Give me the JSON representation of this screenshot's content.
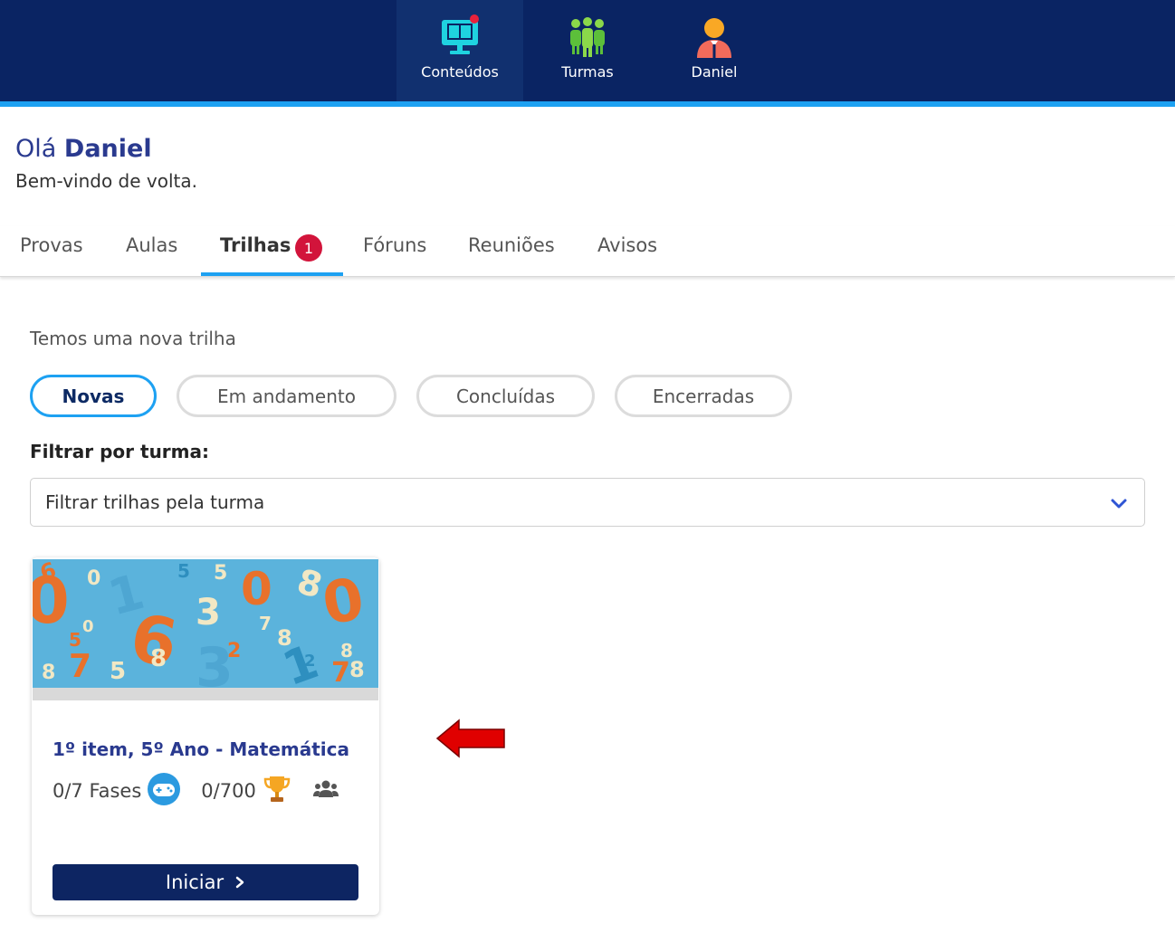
{
  "nav": {
    "items": [
      {
        "label": "Conteúdos",
        "icon": "monitor-book-icon",
        "active": true
      },
      {
        "label": "Turmas",
        "icon": "group-people-icon",
        "active": false
      },
      {
        "label": "Daniel",
        "icon": "user-avatar-icon",
        "active": false
      }
    ]
  },
  "greeting": {
    "hello": "Olá",
    "name": "Daniel",
    "welcome": "Bem-vindo de volta."
  },
  "tabs": {
    "items": [
      "Provas",
      "Aulas",
      "Trilhas",
      "Fóruns",
      "Reuniões",
      "Avisos"
    ],
    "active": "Trilhas",
    "badge": "1"
  },
  "intro": "Temos uma nova trilha",
  "filters": {
    "pills": [
      "Novas",
      "Em andamento",
      "Concluídas",
      "Encerradas"
    ],
    "active": "Novas",
    "label": "Filtrar por turma:",
    "select_placeholder": "Filtrar trilhas pela turma"
  },
  "card": {
    "title": "1º item, 5º Ano - Matemática",
    "phases": "0/7 Fases",
    "points": "0/700",
    "button": "Iniciar",
    "icons": [
      "gamepad-icon",
      "trophy-icon",
      "users-icon"
    ]
  },
  "colors": {
    "navbar": "#0a2463",
    "accent": "#1da1f2",
    "title_blue": "#2a3a8f",
    "badge_red": "#d2143b",
    "button_navy": "#0d2562",
    "arrow_red": "#e00000"
  }
}
